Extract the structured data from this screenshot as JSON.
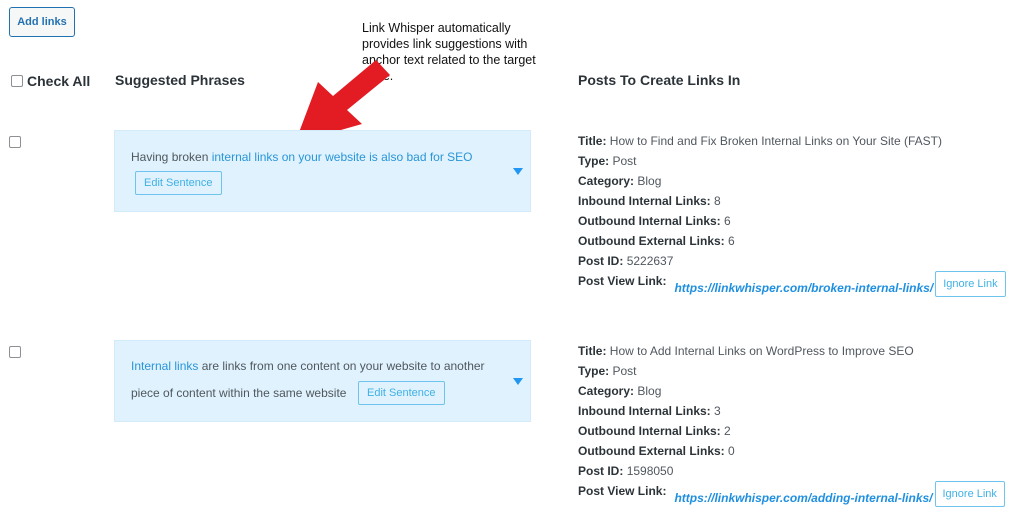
{
  "toolbar": {
    "add_links_label": "Add links"
  },
  "callout": {
    "text": "Link Whisper automatically provides link suggestions with anchor text related to the target page."
  },
  "header": {
    "check_all_label": "Check All",
    "suggested_phrases_label": "Suggested Phrases",
    "posts_label": "Posts To Create Links In"
  },
  "colors": {
    "accent": "#2a95d8",
    "phrase_bg": "#dff2fd",
    "arrow": "#e31b23"
  },
  "rows": [
    {
      "phrase": {
        "before": "Having broken ",
        "link": "internal links on your website is also bad for SEO",
        "after": ""
      },
      "edit_label": "Edit Sentence",
      "post": {
        "title_key": "Title:",
        "title": "How to Find and Fix Broken Internal Links on Your Site (FAST)",
        "type_key": "Type:",
        "type": "Post",
        "category_key": "Category:",
        "category": "Blog",
        "inbound_key": "Inbound Internal Links:",
        "inbound": "8",
        "outbound_key": "Outbound Internal Links:",
        "outbound": "6",
        "external_key": "Outbound External Links:",
        "external": "6",
        "id_key": "Post ID:",
        "id": "5222637",
        "view_key": "Post View Link:",
        "url": "https://linkwhisper.com/broken-internal-links/",
        "ignore_label": "Ignore Link"
      }
    },
    {
      "phrase": {
        "before": "",
        "link": "Internal links",
        "after": " are links from one content on your website to another piece of content within the same website"
      },
      "edit_label": "Edit Sentence",
      "post": {
        "title_key": "Title:",
        "title": "How to Add Internal Links on WordPress to Improve SEO",
        "type_key": "Type:",
        "type": "Post",
        "category_key": "Category:",
        "category": "Blog",
        "inbound_key": "Inbound Internal Links:",
        "inbound": "3",
        "outbound_key": "Outbound Internal Links:",
        "outbound": "2",
        "external_key": "Outbound External Links:",
        "external": "0",
        "id_key": "Post ID:",
        "id": "1598050",
        "view_key": "Post View Link:",
        "url": "https://linkwhisper.com/adding-internal-links/",
        "ignore_label": "Ignore Link"
      }
    }
  ]
}
